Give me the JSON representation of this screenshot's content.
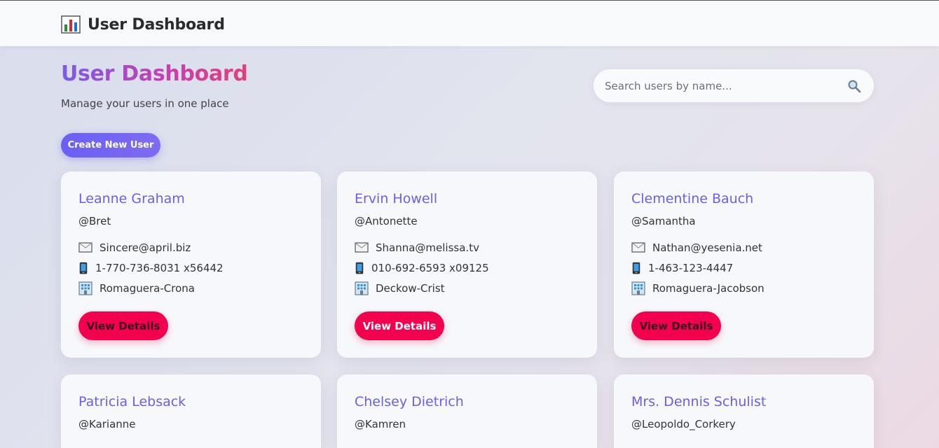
{
  "header": {
    "brand_icon": "bar-chart-icon",
    "brand_title": "User Dashboard"
  },
  "page": {
    "title": "User Dashboard",
    "subtitle": "Manage your users in one place",
    "create_button": "Create New User"
  },
  "search": {
    "placeholder": "Search users by name...",
    "value": "",
    "icon": "magnifier-icon"
  },
  "colors": {
    "accent": "#6a5fe6",
    "button_primary": "#f3004f",
    "create_button": "#6a5ff5"
  },
  "users": [
    {
      "name": "Leanne Graham",
      "username": "@Bret",
      "email": "Sincere@april.biz",
      "phone": "1-770-736-8031 x56442",
      "company": "Romaguera-Crona",
      "button": "View Details"
    },
    {
      "name": "Ervin Howell",
      "username": "@Antonette",
      "email": "Shanna@melissa.tv",
      "phone": "010-692-6593 x09125",
      "company": "Deckow-Crist",
      "button": "View Details"
    },
    {
      "name": "Clementine Bauch",
      "username": "@Samantha",
      "email": "Nathan@yesenia.net",
      "phone": "1-463-123-4447",
      "company": "Romaguera-Jacobson",
      "button": "View Details"
    },
    {
      "name": "Patricia Lebsack",
      "username": "@Karianne"
    },
    {
      "name": "Chelsey Dietrich",
      "username": "@Kamren"
    },
    {
      "name": "Mrs. Dennis Schulist",
      "username": "@Leopoldo_Corkery"
    }
  ]
}
